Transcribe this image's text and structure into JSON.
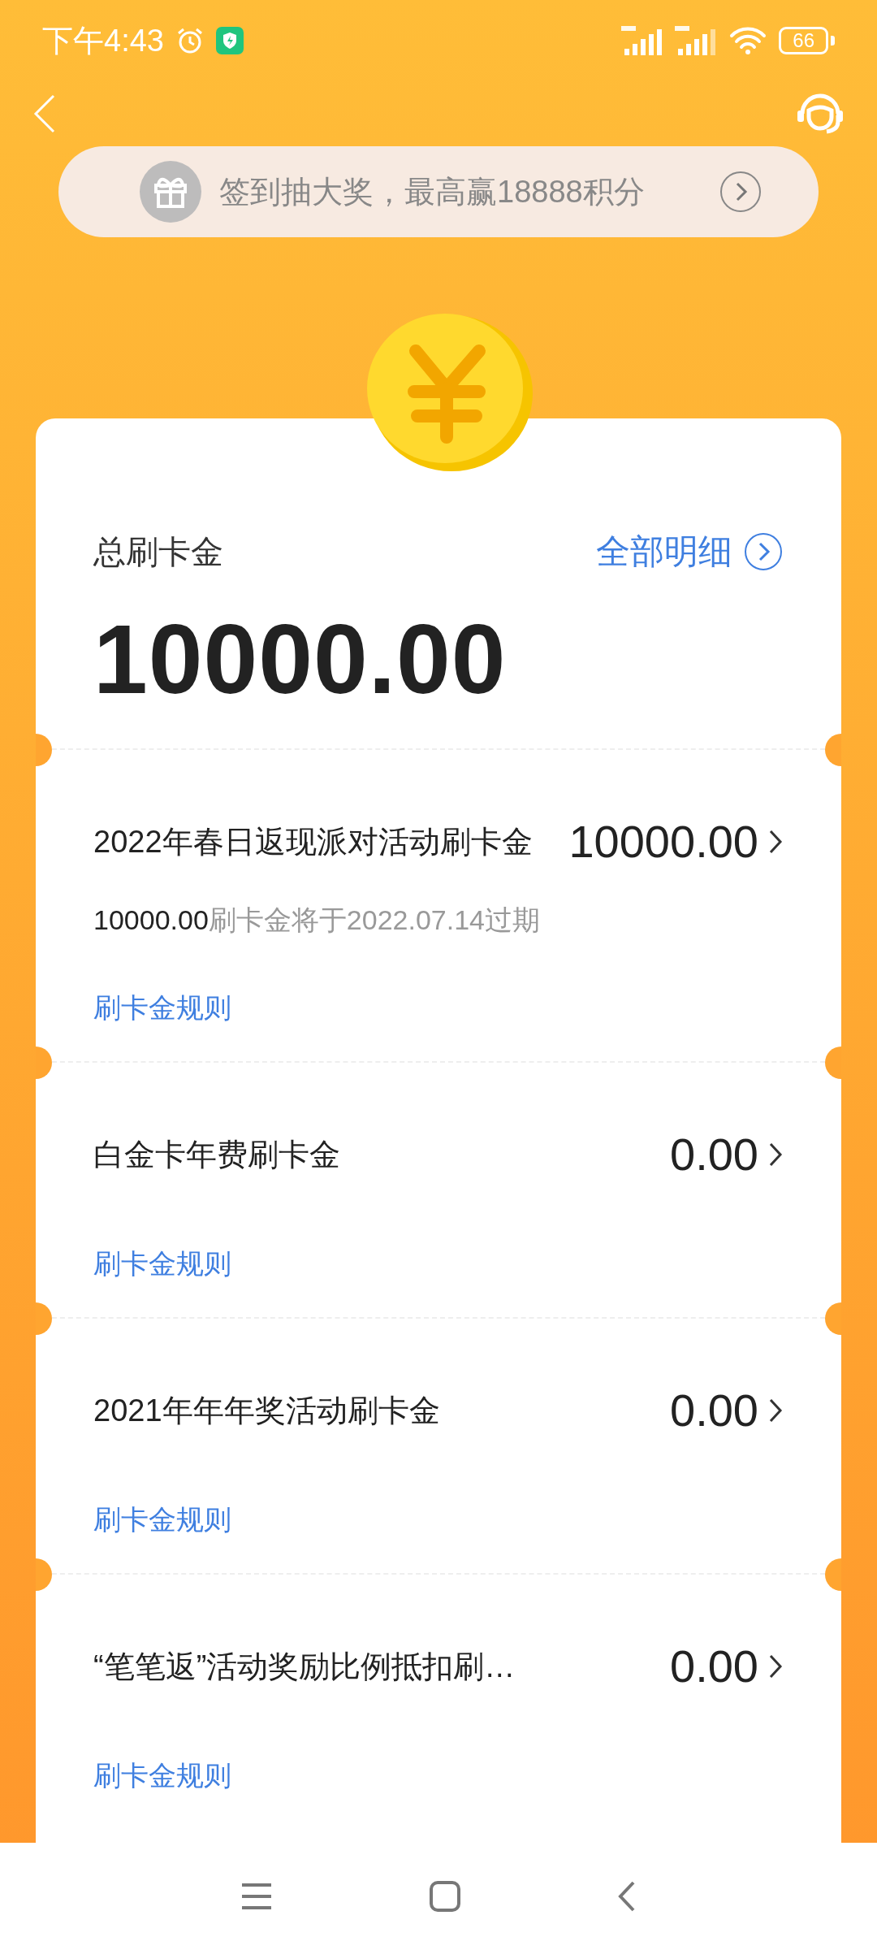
{
  "status_bar": {
    "time": "下午4:43",
    "battery": "66"
  },
  "banner": {
    "text": "签到抽大奖，最高赢18888积分"
  },
  "summary": {
    "label": "总刷卡金",
    "link": "全部明细",
    "amount": "10000.00"
  },
  "items": [
    {
      "title": "2022年春日返现派对活动刷卡金",
      "amount": "10000.00",
      "note_amount": "10000.00",
      "note": "刷卡金将于2022.07.14过期",
      "rules": "刷卡金规则"
    },
    {
      "title": "白金卡年费刷卡金",
      "amount": "0.00",
      "rules": "刷卡金规则"
    },
    {
      "title": "2021年年年奖活动刷卡金",
      "amount": "0.00",
      "rules": "刷卡金规则"
    },
    {
      "title": "“笔笔返”活动奖励比例抵扣刷…",
      "amount": "0.00",
      "rules": "刷卡金规则"
    }
  ]
}
